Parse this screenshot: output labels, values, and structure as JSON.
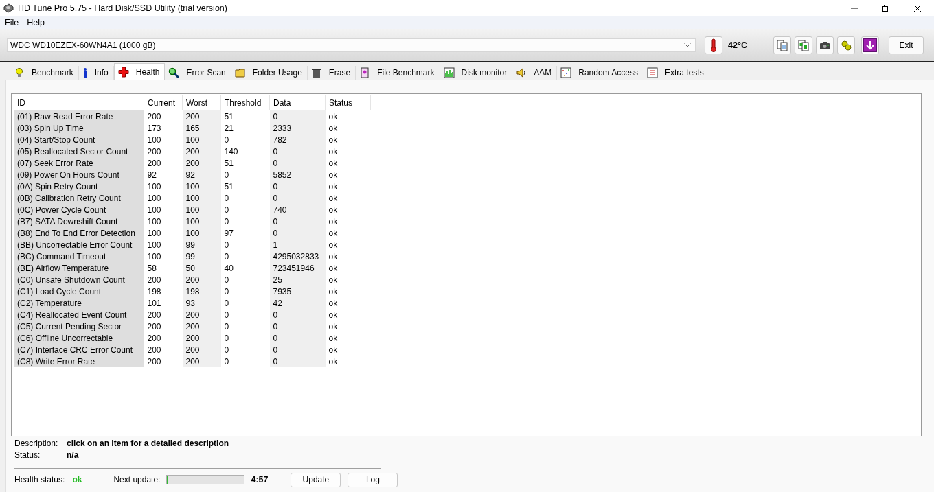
{
  "window": {
    "title": "HD Tune Pro 5.75 - Hard Disk/SSD Utility (trial version)"
  },
  "menu": [
    "File",
    "Help"
  ],
  "toolbar": {
    "drive": "WDC WD10EZEX-60WN4A1 (1000 gB)",
    "temperature": "42°C",
    "exit": "Exit"
  },
  "tabs": [
    {
      "label": "Benchmark",
      "selected": false
    },
    {
      "label": "Info",
      "selected": false
    },
    {
      "label": "Health",
      "selected": true
    },
    {
      "label": "Error Scan",
      "selected": false
    },
    {
      "label": "Folder Usage",
      "selected": false
    },
    {
      "label": "Erase",
      "selected": false
    },
    {
      "label": "File Benchmark",
      "selected": false
    },
    {
      "label": "Disk monitor",
      "selected": false
    },
    {
      "label": "AAM",
      "selected": false
    },
    {
      "label": "Random Access",
      "selected": false
    },
    {
      "label": "Extra tests",
      "selected": false
    }
  ],
  "table": {
    "columns": [
      "ID",
      "Current",
      "Worst",
      "Threshold",
      "Data",
      "Status"
    ],
    "rows": [
      [
        "(01) Raw Read Error Rate",
        "200",
        "200",
        "51",
        "0",
        "ok"
      ],
      [
        "(03) Spin Up Time",
        "173",
        "165",
        "21",
        "2333",
        "ok"
      ],
      [
        "(04) Start/Stop Count",
        "100",
        "100",
        "0",
        "782",
        "ok"
      ],
      [
        "(05) Reallocated Sector Count",
        "200",
        "200",
        "140",
        "0",
        "ok"
      ],
      [
        "(07) Seek Error Rate",
        "200",
        "200",
        "51",
        "0",
        "ok"
      ],
      [
        "(09) Power On Hours Count",
        "92",
        "92",
        "0",
        "5852",
        "ok"
      ],
      [
        "(0A) Spin Retry Count",
        "100",
        "100",
        "51",
        "0",
        "ok"
      ],
      [
        "(0B) Calibration Retry Count",
        "100",
        "100",
        "0",
        "0",
        "ok"
      ],
      [
        "(0C) Power Cycle Count",
        "100",
        "100",
        "0",
        "740",
        "ok"
      ],
      [
        "(B7) SATA Downshift Count",
        "100",
        "100",
        "0",
        "0",
        "ok"
      ],
      [
        "(B8) End To End Error Detection",
        "100",
        "100",
        "97",
        "0",
        "ok"
      ],
      [
        "(BB) Uncorrectable Error Count",
        "100",
        "99",
        "0",
        "1",
        "ok"
      ],
      [
        "(BC) Command Timeout",
        "100",
        "99",
        "0",
        "4295032833",
        "ok"
      ],
      [
        "(BE) Airflow Temperature",
        "58",
        "50",
        "40",
        "723451946",
        "ok"
      ],
      [
        "(C0) Unsafe Shutdown Count",
        "200",
        "200",
        "0",
        "25",
        "ok"
      ],
      [
        "(C1) Load Cycle Count",
        "198",
        "198",
        "0",
        "7935",
        "ok"
      ],
      [
        "(C2) Temperature",
        "101",
        "93",
        "0",
        "42",
        "ok"
      ],
      [
        "(C4) Reallocated Event Count",
        "200",
        "200",
        "0",
        "0",
        "ok"
      ],
      [
        "(C5) Current Pending Sector",
        "200",
        "200",
        "0",
        "0",
        "ok"
      ],
      [
        "(C6) Offline Uncorrectable",
        "200",
        "200",
        "0",
        "0",
        "ok"
      ],
      [
        "(C7) Interface CRC Error Count",
        "200",
        "200",
        "0",
        "0",
        "ok"
      ],
      [
        "(C8) Write Error Rate",
        "200",
        "200",
        "0",
        "0",
        "ok"
      ]
    ]
  },
  "details": [
    {
      "label": "Description:",
      "value": "click on an item for a detailed description"
    },
    {
      "label": "Status:",
      "value": "n/a"
    }
  ],
  "footer": {
    "health_label": "Health status:",
    "health_value": "ok",
    "next_label": "Next update:",
    "progress": {
      "level": 0.01
    },
    "countdown": "4:57",
    "buttons": [
      "Update",
      "Log"
    ]
  }
}
